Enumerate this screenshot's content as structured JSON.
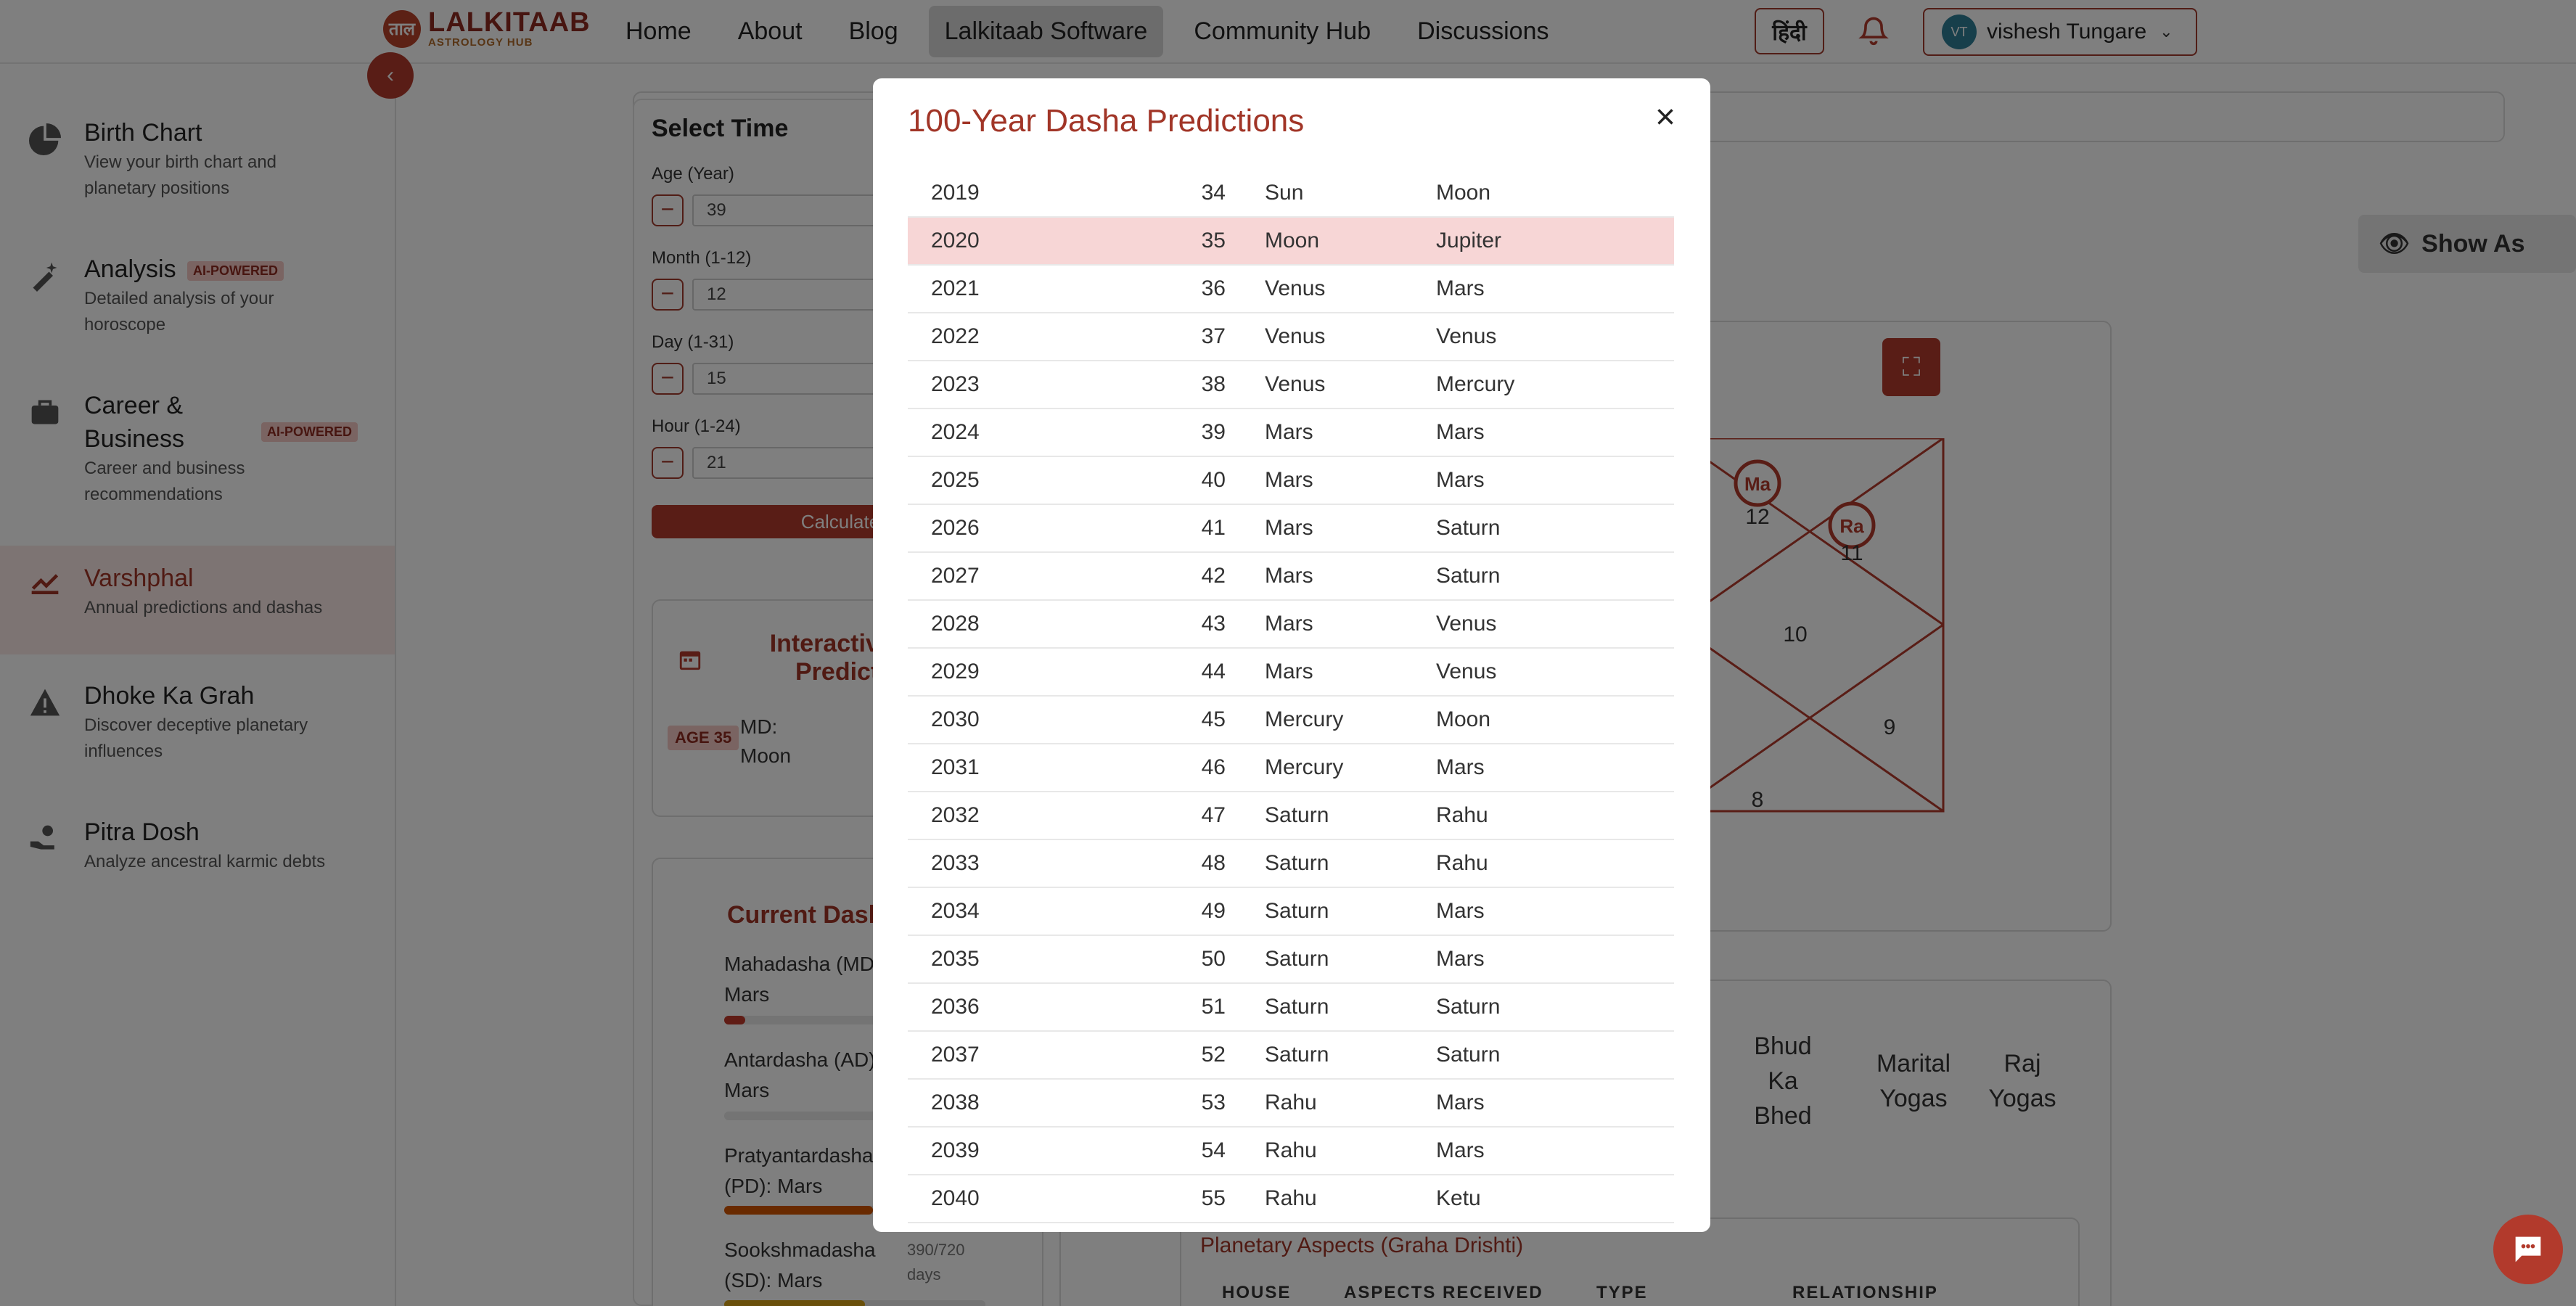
{
  "brand": {
    "mark": "ताल",
    "name": "LALKITAAB",
    "tagline": "ASTROLOGY HUB"
  },
  "nav": {
    "links": [
      "Home",
      "About",
      "Blog",
      "Lalkitaab Software",
      "Community Hub",
      "Discussions"
    ],
    "active_index": 3,
    "language_button": "हिंदी",
    "user": {
      "initials": "VT",
      "name": "vishesh Tungare"
    }
  },
  "sidebar": {
    "items": [
      {
        "title": "Birth Chart",
        "desc": "View your birth chart and planetary positions",
        "icon": "pie-chart-icon"
      },
      {
        "title": "Analysis",
        "badge": "AI-POWERED",
        "desc": "Detailed analysis of your horoscope",
        "icon": "magic-wand-icon"
      },
      {
        "title": "Career & Business",
        "badge": "AI-POWERED",
        "desc": "Career and business recommendations",
        "icon": "briefcase-icon"
      },
      {
        "title": "Varshphal",
        "desc": "Annual predictions and dashas",
        "icon": "trend-chart-icon",
        "active": true
      },
      {
        "title": "Dhoke Ka Grah",
        "desc": "Discover deceptive planetary influences",
        "icon": "warning-icon"
      },
      {
        "title": "Pitra Dosh",
        "desc": "Analyze ancestral karmic debts",
        "icon": "hand-care-icon"
      }
    ]
  },
  "select_time": {
    "title": "Select Time",
    "fields": [
      {
        "label": "Age (Year)",
        "value": "39"
      },
      {
        "label": "Month (1-12)",
        "value": "12"
      },
      {
        "label": "Day (1-31)",
        "value": "15"
      },
      {
        "label": "Hour (1-24)",
        "value": "21"
      }
    ],
    "calculate_label": "Calculate"
  },
  "interactive": {
    "title_line1": "Interactive",
    "title_line2": "Predictio",
    "age_badge": "AGE 35",
    "md_label": "MD:",
    "md_value": "Moon"
  },
  "current_dasha": {
    "title": "Current Dasha",
    "rows": [
      {
        "label": "Mahadasha (MD):",
        "value": "Mars",
        "progress": 0.08,
        "color": "#c0392b"
      },
      {
        "label": "Antardasha (AD):",
        "value": "Mars",
        "progress": 0.0,
        "color": "#c0392b"
      },
      {
        "label": "Pratyantardasha",
        "label2": "(PD):",
        "value": "Mars",
        "progress": 0.57,
        "color": "#d35400"
      },
      {
        "label": "Sookshmadasha",
        "label2": "(SD):",
        "value": "Mars",
        "progress": 0.54,
        "color": "#d4a017",
        "days": "390/720",
        "days_unit": "days"
      }
    ]
  },
  "chart": {
    "show_button": "Show As",
    "planets": [
      "Ma",
      "Ra"
    ],
    "houses": [
      "12",
      "11",
      "10",
      "9",
      "8"
    ]
  },
  "tabs": [
    "Bhud Ka Bhed",
    "Marital Yogas",
    "Raj Yogas"
  ],
  "aspects": {
    "title": "Planetary Aspects (Graha Drishti)",
    "columns": [
      "HOUSE",
      "ASPECTS RECEIVED",
      "TYPE",
      "RELATIONSHIP"
    ]
  },
  "modal": {
    "title": "100-Year Dasha Predictions",
    "highlight_year": "2020",
    "rows": [
      [
        "2019",
        "34",
        "Sun",
        "Moon"
      ],
      [
        "2020",
        "35",
        "Moon",
        "Jupiter"
      ],
      [
        "2021",
        "36",
        "Venus",
        "Mars"
      ],
      [
        "2022",
        "37",
        "Venus",
        "Venus"
      ],
      [
        "2023",
        "38",
        "Venus",
        "Mercury"
      ],
      [
        "2024",
        "39",
        "Mars",
        "Mars"
      ],
      [
        "2025",
        "40",
        "Mars",
        "Mars"
      ],
      [
        "2026",
        "41",
        "Mars",
        "Saturn"
      ],
      [
        "2027",
        "42",
        "Mars",
        "Saturn"
      ],
      [
        "2028",
        "43",
        "Mars",
        "Venus"
      ],
      [
        "2029",
        "44",
        "Mars",
        "Venus"
      ],
      [
        "2030",
        "45",
        "Mercury",
        "Moon"
      ],
      [
        "2031",
        "46",
        "Mercury",
        "Mars"
      ],
      [
        "2032",
        "47",
        "Saturn",
        "Rahu"
      ],
      [
        "2033",
        "48",
        "Saturn",
        "Rahu"
      ],
      [
        "2034",
        "49",
        "Saturn",
        "Mars"
      ],
      [
        "2035",
        "50",
        "Saturn",
        "Mars"
      ],
      [
        "2036",
        "51",
        "Saturn",
        "Saturn"
      ],
      [
        "2037",
        "52",
        "Saturn",
        "Saturn"
      ],
      [
        "2038",
        "53",
        "Rahu",
        "Mars"
      ],
      [
        "2039",
        "54",
        "Rahu",
        "Mars"
      ],
      [
        "2040",
        "55",
        "Rahu",
        "Ketu"
      ]
    ]
  },
  "colors": {
    "accent": "#a13527",
    "accent_button": "#b23a2c",
    "highlight_row": "#f7d6d6",
    "overlay": "rgba(0,0,0,0.5)"
  }
}
